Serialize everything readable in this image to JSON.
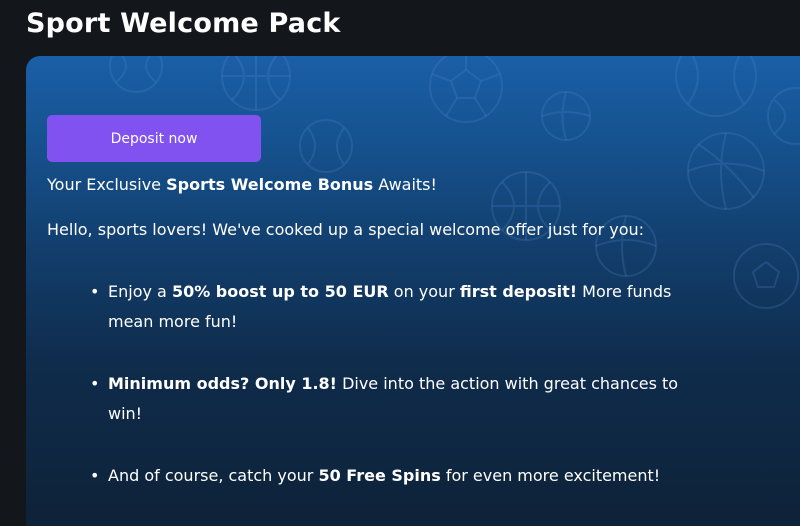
{
  "page": {
    "title": "Sport Welcome Pack"
  },
  "promo": {
    "deposit_button_label": "Deposit now",
    "intro": {
      "pre": "Your Exclusive ",
      "bold": "Sports Welcome Bonus",
      "post": " Awaits!"
    },
    "greeting": "Hello, sports lovers! We've cooked up a special welcome offer just for you:",
    "offers": [
      {
        "p1": "Enjoy a ",
        "b1": "50% boost up to 50 EUR",
        "p2": " on your ",
        "b2": "first deposit!",
        "p3": " More funds mean more fun!"
      },
      {
        "b1": "Minimum odds? Only 1.8!",
        "p1": " Dive into the action with great chances to win!"
      },
      {
        "p1": "And of course, catch your ",
        "b1": "50 Free Spins",
        "p2": " for even more excitement!"
      }
    ]
  },
  "colors": {
    "page_background": "#13171c",
    "card_gradient_top": "#1a5fa7",
    "card_gradient_bottom": "#0e2238",
    "button_accent": "#8152ef",
    "text": "#ffffff"
  },
  "icons": [
    "basketball-icon",
    "soccer-ball-icon",
    "baseball-icon",
    "tennis-ball-icon",
    "volleyball-icon",
    "bullet-icon"
  ]
}
